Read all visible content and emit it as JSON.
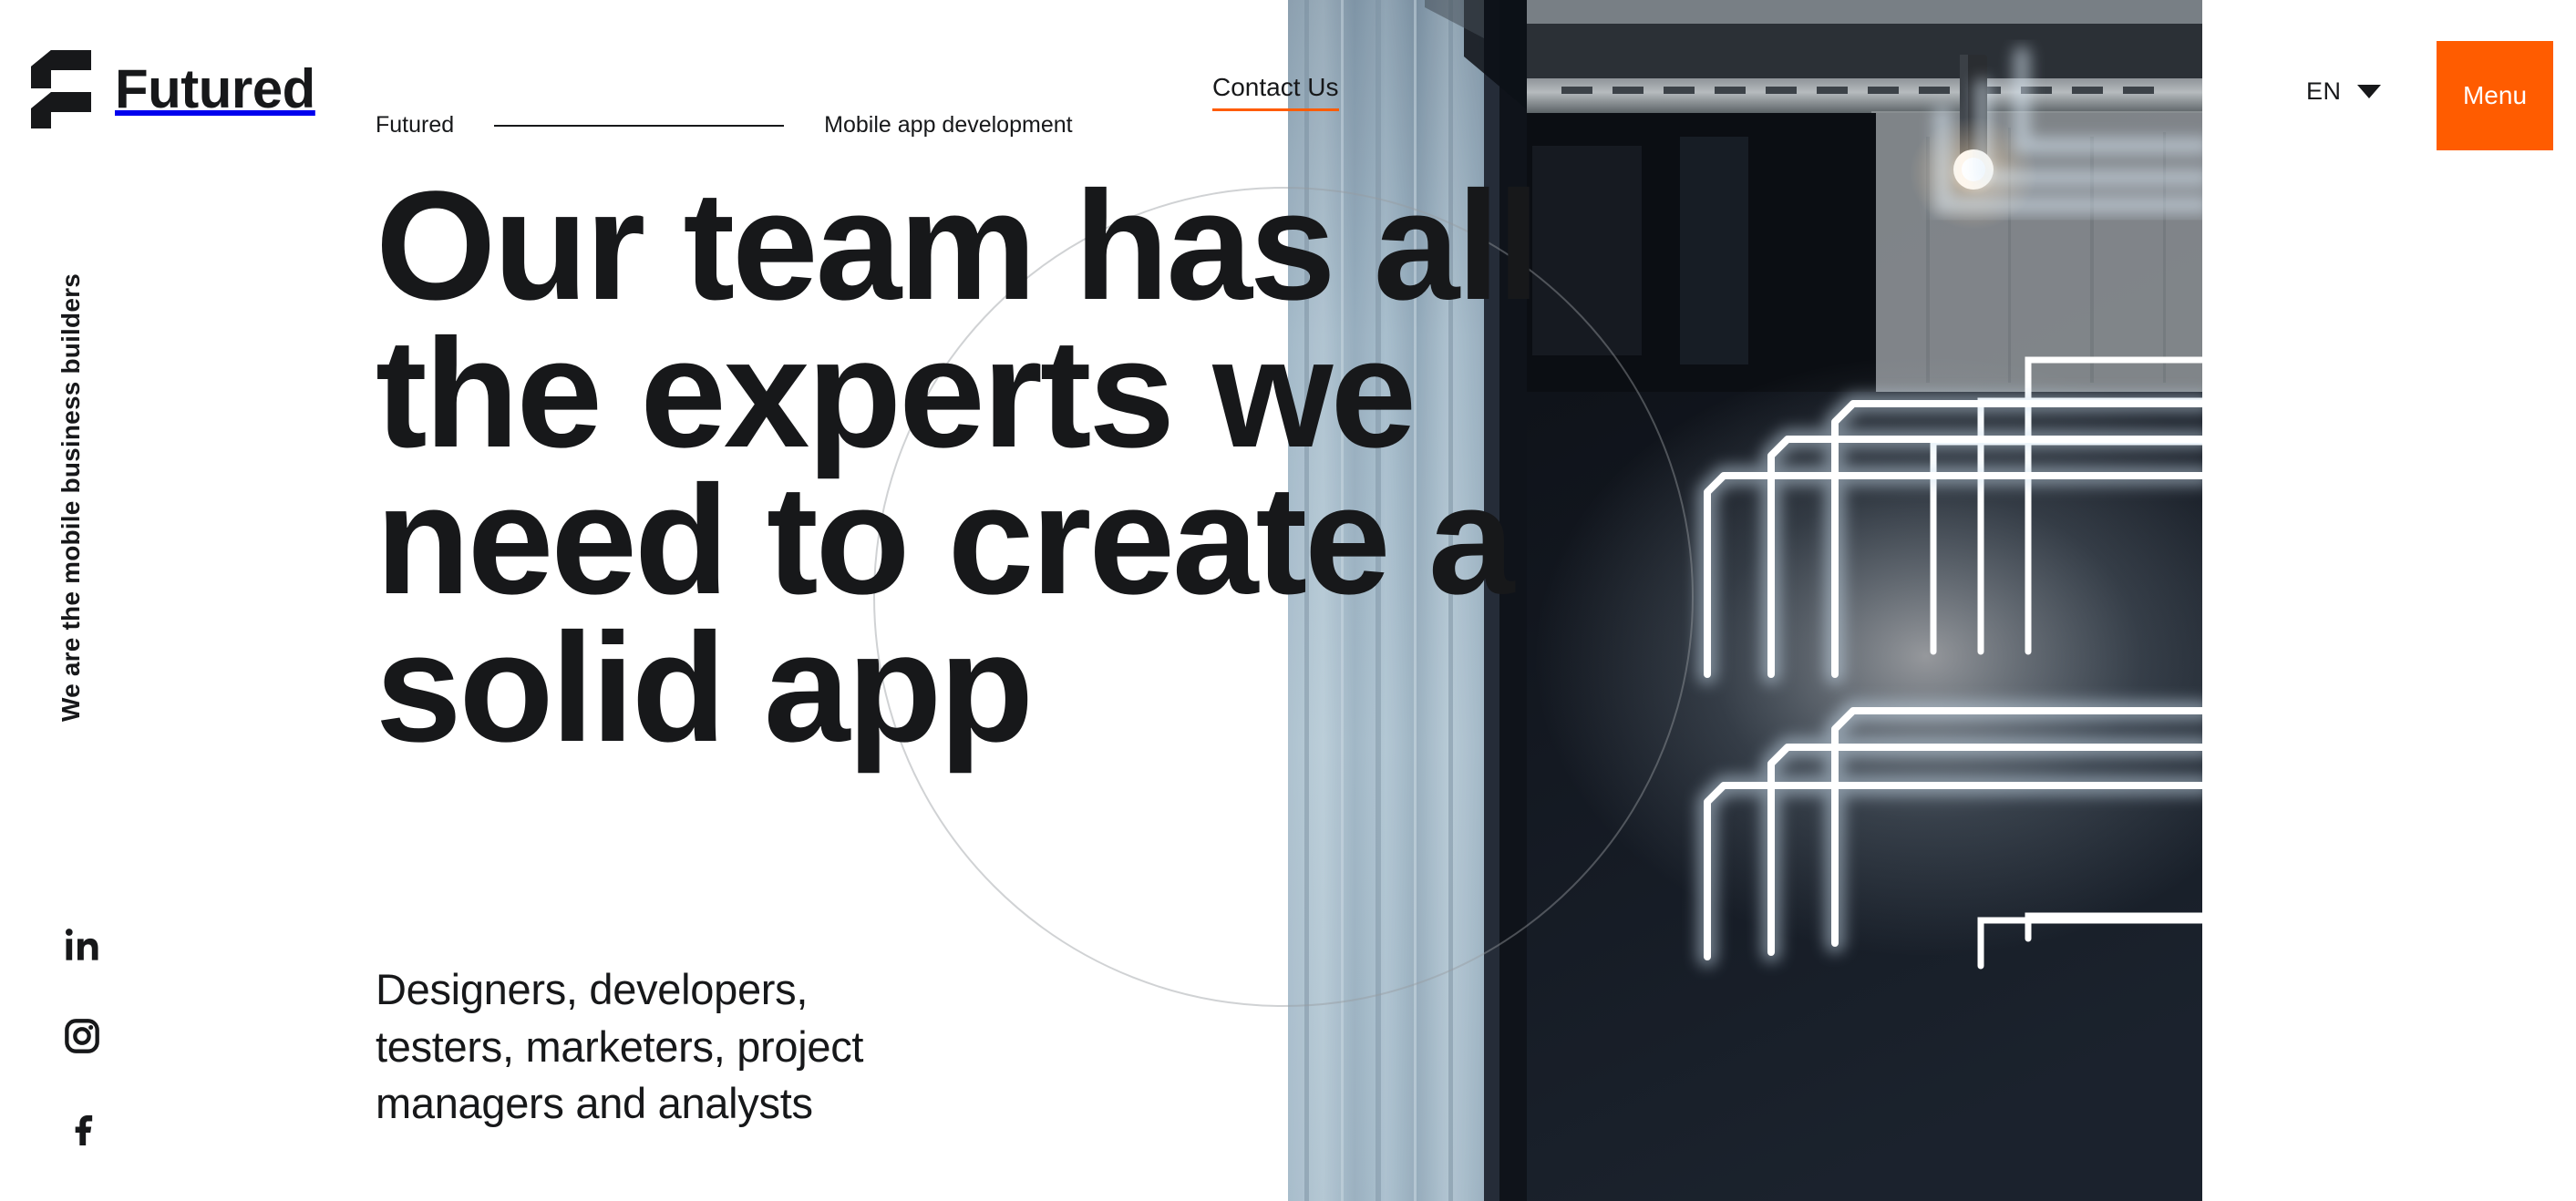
{
  "brand": {
    "logo_icon": "futured-f-logo",
    "name": "Futured"
  },
  "breadcrumb": {
    "items": [
      "Futured",
      "Mobile app development"
    ]
  },
  "header": {
    "contact_label": "Contact Us",
    "language": "EN",
    "language_caret_icon": "chevron-down-icon",
    "menu_label": "Menu"
  },
  "left_rail": {
    "tagline": "We are the mobile business builders",
    "socials": [
      {
        "name": "linkedin-icon",
        "label": "in"
      },
      {
        "name": "instagram-icon",
        "label": "Instagram"
      },
      {
        "name": "facebook-icon",
        "label": "f"
      }
    ]
  },
  "hero": {
    "lines": [
      "Our team has all",
      "the experts we",
      "need to create a",
      "solid app"
    ],
    "subtitle_lines": [
      "Designers, developers,",
      "testers, marketers, project",
      "managers and analysts"
    ]
  },
  "colors": {
    "accent": "#FF5C00",
    "text": "#17181A",
    "background": "#FFFFFF",
    "photo_dark": "#11151C",
    "photo_glass": "#8FA9BC"
  },
  "media": {
    "photo_alt": "dark office interior with glass partition and neon tube lights"
  }
}
